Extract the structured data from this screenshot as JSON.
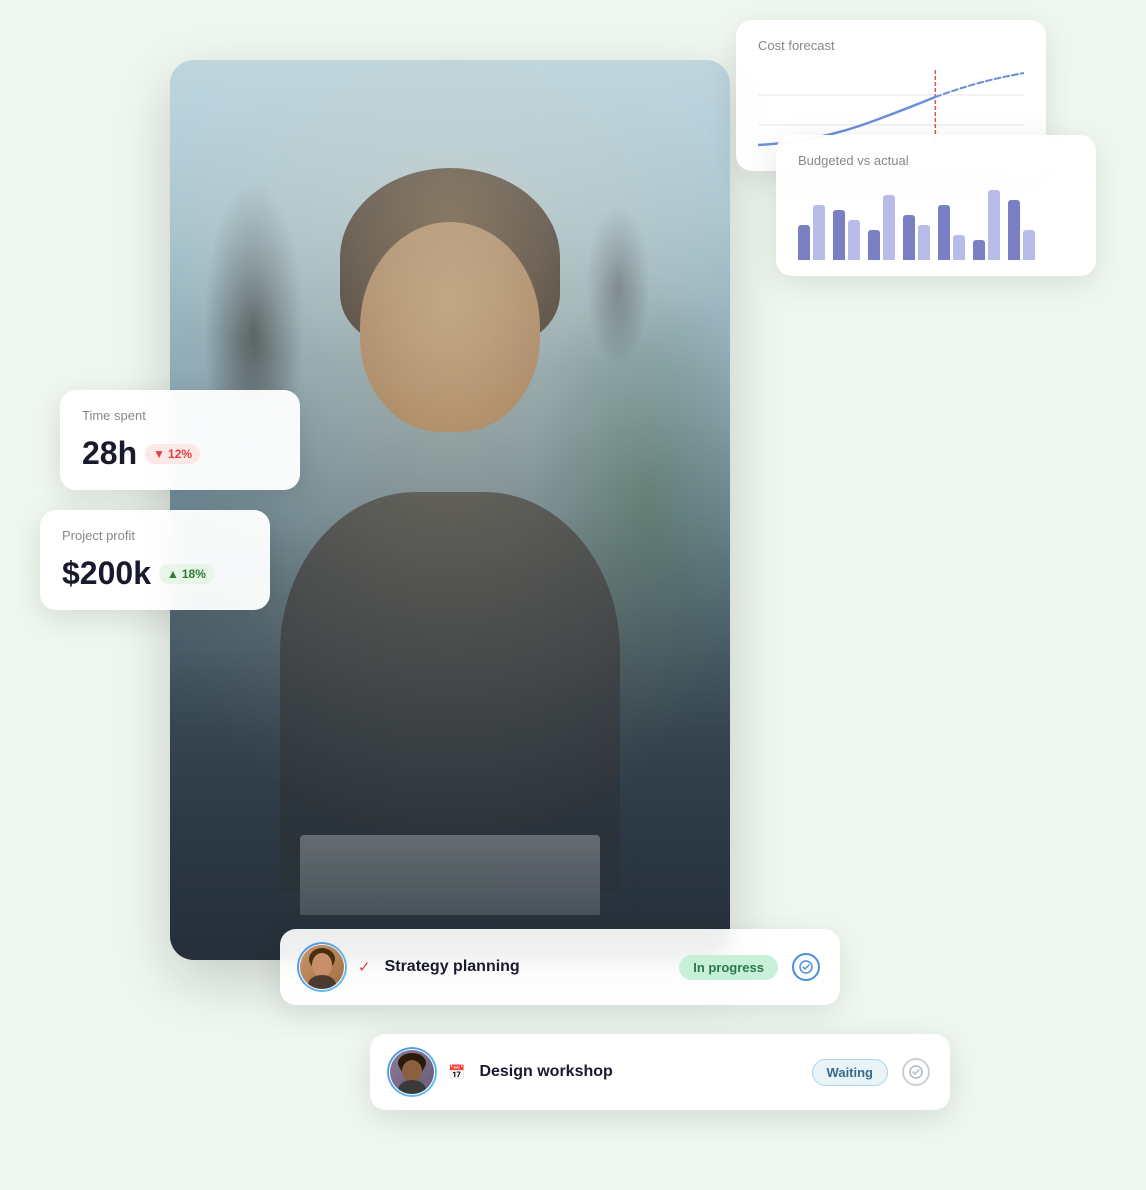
{
  "background_color": "#e8f4e8",
  "widgets": {
    "cost_forecast": {
      "title": "Cost forecast",
      "chart": {
        "actual_line": "curve going up",
        "forecast_line": "dashed curve going higher",
        "divider_color": "#e05050"
      }
    },
    "budgeted_vs_actual": {
      "title": "Budgeted vs actual",
      "bars": [
        {
          "dark": 35,
          "light": 55
        },
        {
          "dark": 50,
          "light": 40
        },
        {
          "dark": 30,
          "light": 65
        },
        {
          "dark": 45,
          "light": 35
        },
        {
          "dark": 55,
          "light": 25
        },
        {
          "dark": 20,
          "light": 70
        },
        {
          "dark": 60,
          "light": 30
        }
      ]
    },
    "time_spent": {
      "label": "Time spent",
      "value": "28h",
      "badge_value": "12%",
      "badge_direction": "down",
      "badge_color": "red"
    },
    "project_profit": {
      "label": "Project profit",
      "value": "$200k",
      "badge_value": "18%",
      "badge_direction": "up",
      "badge_color": "green"
    },
    "task_1": {
      "name": "Strategy planning",
      "icon": "checkmark",
      "status": "In progress",
      "status_type": "in-progress"
    },
    "task_2": {
      "name": "Design workshop",
      "icon": "calendar",
      "status": "Waiting",
      "status_type": "waiting"
    }
  }
}
